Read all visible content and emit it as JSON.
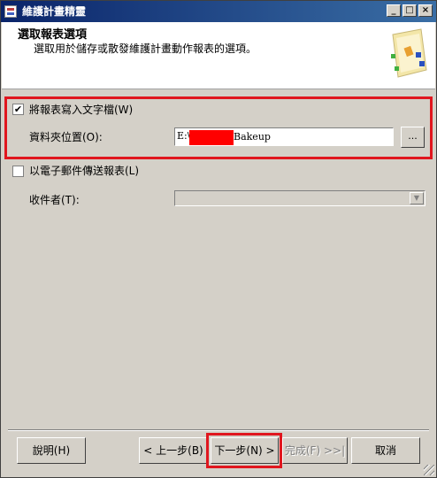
{
  "window": {
    "title": "維護計畫精靈",
    "icon": "wizard-app-icon",
    "controls": [
      "minimize-icon",
      "maximize-icon",
      "close-icon"
    ]
  },
  "header": {
    "title": "選取報表選項",
    "description": "選取用於儲存或散發維護計畫動作報表的選項。"
  },
  "report_file": {
    "checkbox_label": "將報表寫入文字檔(W)",
    "checked": true,
    "folder_label": "資料夾位置(O):",
    "folder_value_prefix": "E:\\",
    "folder_value_suffix": "Bakeup",
    "browse_label": "..."
  },
  "email_report": {
    "checkbox_label": "以電子郵件傳送報表(L)",
    "checked": false,
    "recipient_label": "收件者(T):",
    "recipient_value": ""
  },
  "footer": {
    "help_label": "說明(H)",
    "back_label": "< 上一步(B)",
    "next_label": "下一步(N) >",
    "finish_label": "完成(F) >>|",
    "cancel_label": "取消"
  },
  "colors": {
    "highlight": "#e0161e",
    "redaction": "#ff0000",
    "title_bar": "#0a246a",
    "dialog_bg": "#d4d0c8"
  }
}
